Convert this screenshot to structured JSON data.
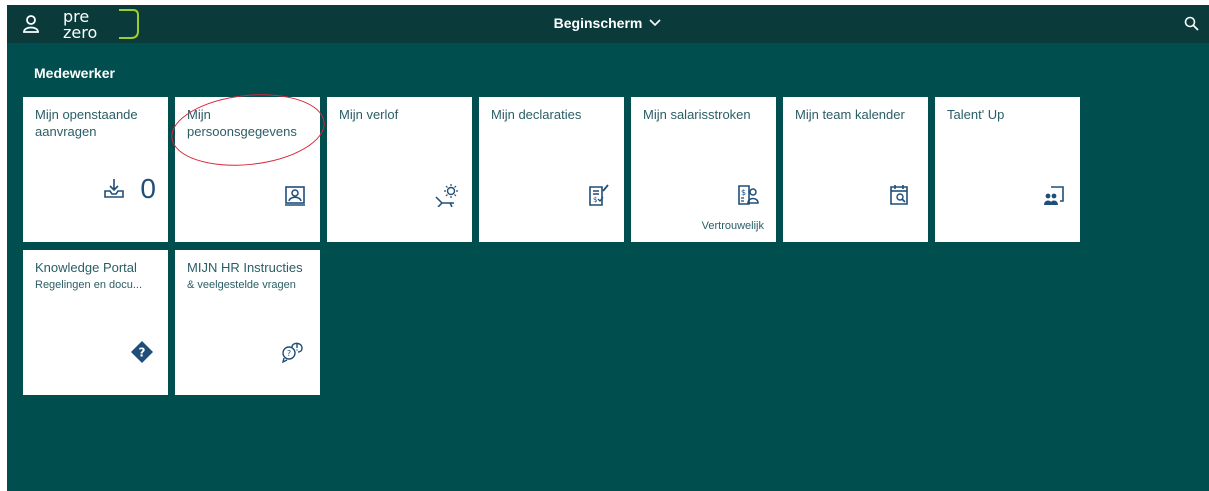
{
  "shell": {
    "title": "Beginscherm",
    "logo_text_top": "pre",
    "logo_text_bottom": "zero",
    "icons": {
      "user": "user-icon",
      "search": "search-icon",
      "dropdown": "chevron-down-icon"
    }
  },
  "group": {
    "title": "Medewerker"
  },
  "tiles": [
    {
      "title": "Mijn openstaande aanvragen",
      "count": "0",
      "icon": "inbox-download-icon"
    },
    {
      "title": "Mijn persoonsgegevens",
      "icon": "id-card-icon"
    },
    {
      "title": "Mijn verlof",
      "icon": "beach-chair-sun-icon"
    },
    {
      "title": "Mijn declaraties",
      "icon": "expense-report-icon"
    },
    {
      "title": "Mijn salarisstroken",
      "footer": "Vertrouwelijk",
      "icon": "payslip-icon"
    },
    {
      "title": "Mijn team kalender",
      "icon": "calendar-search-icon"
    },
    {
      "title": "Talent' Up",
      "icon": "people-board-icon"
    },
    {
      "title": "Knowledge Portal",
      "subtitle": "Regelingen en docu...",
      "icon": "question-diamond-icon"
    },
    {
      "title": "MIJN HR Instructies",
      "subtitle": "& veelgestelde vragen",
      "icon": "chat-question-icon"
    }
  ],
  "colors": {
    "background": "#004e4e",
    "shell": "#0a3a3a",
    "tile": "#ffffff",
    "tile_text": "#2a5e66",
    "icon": "#1f4e79",
    "annotation": "#d9263b",
    "logo_accent": "#9acd32"
  }
}
